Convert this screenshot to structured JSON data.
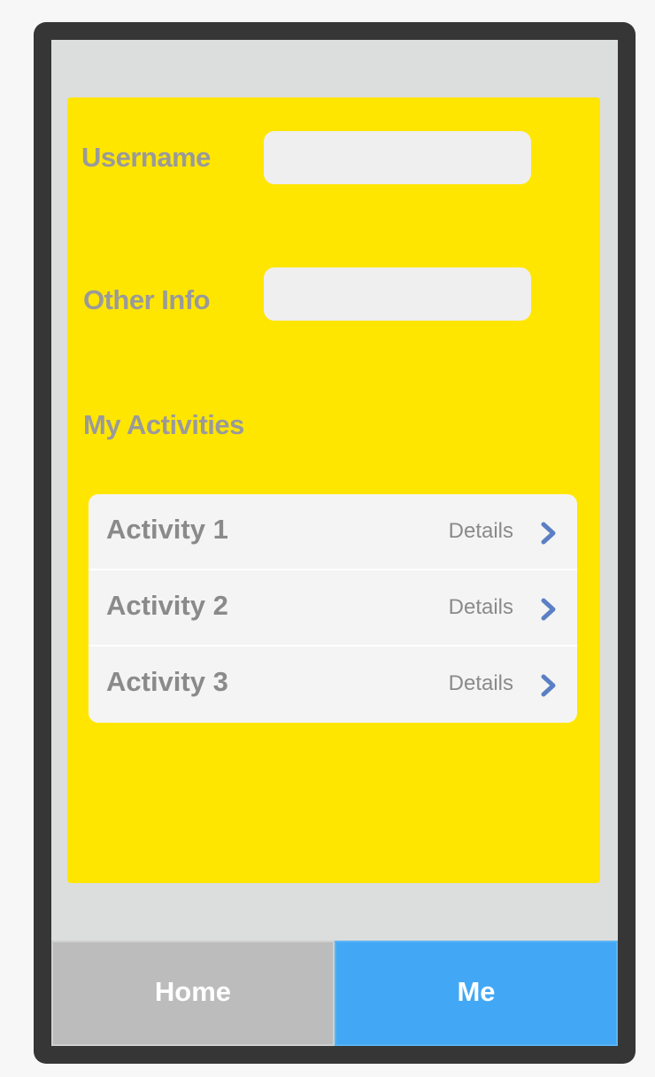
{
  "form": {
    "username_label": "Username",
    "username_value": "",
    "other_info_label": "Other Info",
    "other_info_value": "",
    "activities_label": "My Activities"
  },
  "activities": [
    {
      "title": "Activity 1",
      "details_label": "Details",
      "icon": "chevron-right-icon"
    },
    {
      "title": "Activity 2",
      "details_label": "Details",
      "icon": "chevron-right-icon"
    },
    {
      "title": "Activity 3",
      "details_label": "Details",
      "icon": "chevron-right-icon"
    }
  ],
  "tabbar": {
    "home_label": "Home",
    "me_label": "Me",
    "active_tab": "Me"
  },
  "colors": {
    "panel": "#ffe600",
    "active_tab": "#42a8f5",
    "inactive_tab": "#bcbcbc",
    "chevron": "#5b7fc4"
  }
}
